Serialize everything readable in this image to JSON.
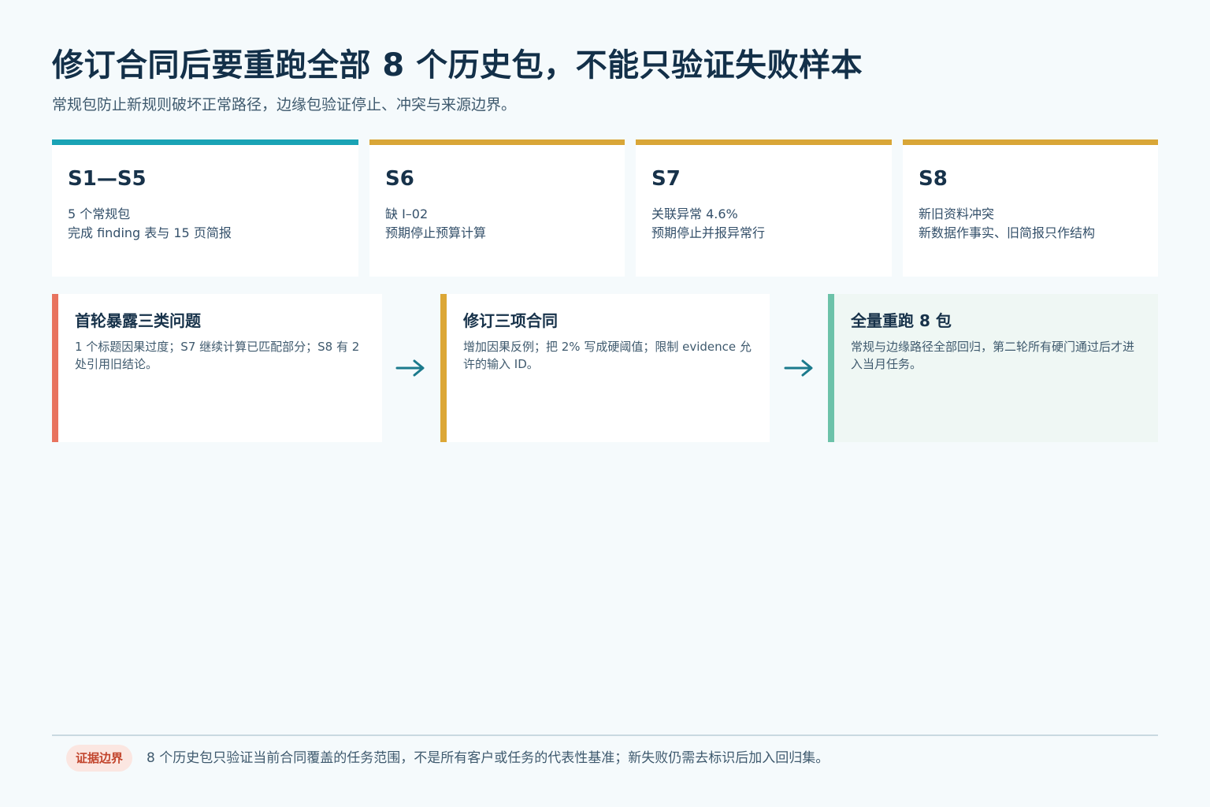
{
  "header": {
    "title": "修订合同后要重跑全部 8 个历史包，不能只验证失败样本",
    "subtitle": "常规包防止新规则破坏正常路径，边缘包验证停止、冲突与来源边界。"
  },
  "packs": [
    {
      "code": "S1—S5",
      "lines": [
        "5 个常规包",
        "完成 finding 表与 15 页简报"
      ]
    },
    {
      "code": "S6",
      "lines": [
        "缺 I–02",
        "预期停止预算计算"
      ]
    },
    {
      "code": "S7",
      "lines": [
        "关联异常 4.6%",
        "预期停止并报异常行"
      ]
    },
    {
      "code": "S8",
      "lines": [
        "新旧资料冲突",
        "新数据作事实、旧简报只作结构"
      ]
    }
  ],
  "flow": {
    "steps": [
      {
        "title": "首轮暴露三类问题",
        "body": "1 个标题因果过度；S7 继续计算已匹配部分；S8 有 2 处引用旧结论。"
      },
      {
        "title": "修订三项合同",
        "body": "增加因果反例；把 2% 写成硬阈值；限制 evidence 允许的输入 ID。"
      },
      {
        "title": "全量重跑 8 包",
        "body": "常规与边缘路径全部回归，第二轮所有硬门通过后才进入当月任务。"
      }
    ]
  },
  "footer": {
    "badge": "证据边界",
    "note": "8 个历史包只验证当前合同覆盖的任务范围，不是所有客户或任务的代表性基准；新失败仍需去标识后加入回归集。"
  },
  "colors": {
    "regular_accent": "#1aa3b5",
    "edge_accent": "#d9a637",
    "issue_accent": "#e8735f",
    "revise_accent": "#dca736",
    "rerun_accent": "#6cc2a9",
    "arrow": "#1b7a8c",
    "badge_text": "#c2452d"
  }
}
